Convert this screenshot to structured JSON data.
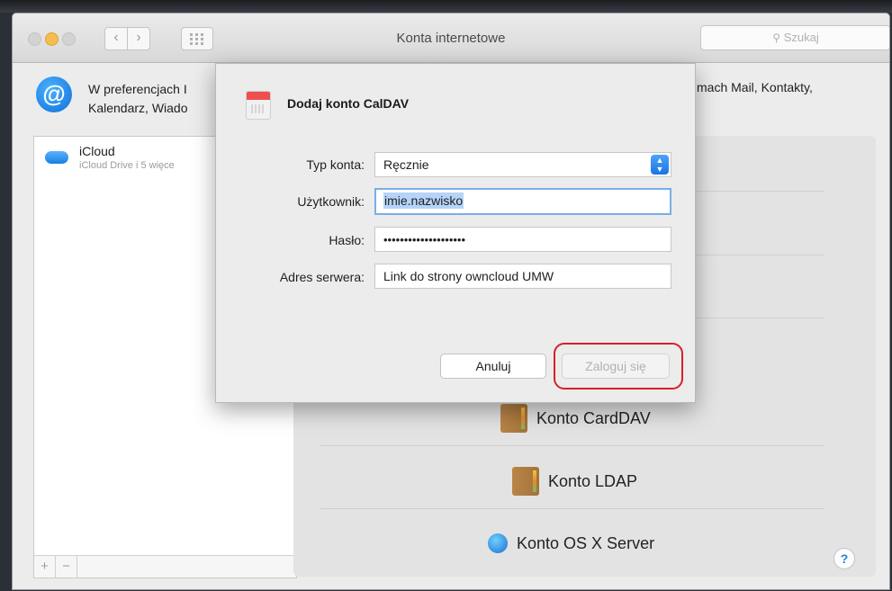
{
  "window": {
    "title": "Konta internetowe",
    "search_placeholder": "Szukaj"
  },
  "header": {
    "description_line1": "W preferencjach I",
    "description_line2": "Kalendarz, Wiado",
    "description_right": "mach Mail, Kontakty,"
  },
  "sidebar": {
    "accounts": [
      {
        "name": "iCloud",
        "subtitle": "iCloud Drive i 5 więce",
        "icon": "icloud-icon"
      }
    ],
    "add_label": "+",
    "remove_label": "−"
  },
  "providers": [
    {
      "label": "Konto CardDAV",
      "icon": "contacts-book-icon"
    },
    {
      "label": "Konto LDAP",
      "icon": "contacts-book-icon"
    },
    {
      "label": "Konto OS X Server",
      "icon": "server-globe-icon"
    }
  ],
  "help_label": "?",
  "dialog": {
    "title": "Dodaj konto CalDAV",
    "fields": {
      "account_type_label": "Typ konta:",
      "account_type_value": "Ręcznie",
      "user_label": "Użytkownik:",
      "user_value": "imie.nazwisko",
      "password_label": "Hasło:",
      "password_value": "••••••••••••••••••••",
      "server_label": "Adres serwera:",
      "server_value": "Link do strony owncloud UMW"
    },
    "cancel_label": "Anuluj",
    "login_label": "Zaloguj się"
  },
  "colors": {
    "accent": "#1a73e8",
    "highlight_ring": "#d6202a"
  }
}
